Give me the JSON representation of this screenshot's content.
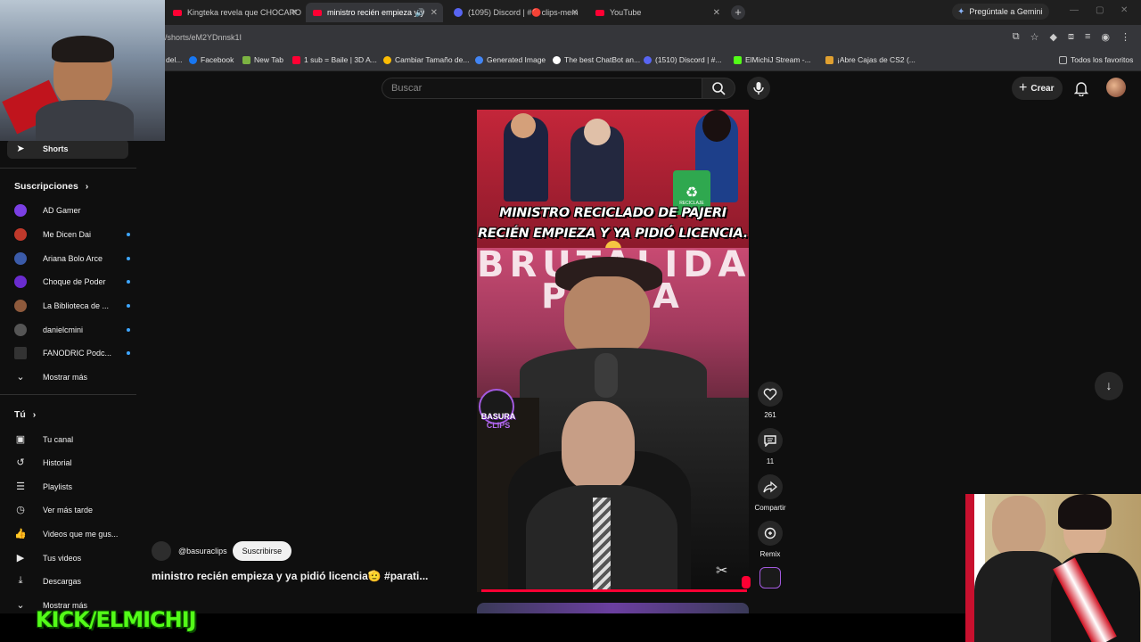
{
  "browser": {
    "tabs": [
      {
        "title": "Kingteka revela que CHOCARO",
        "icon": "youtube-icon"
      },
      {
        "title": "ministro recién empieza y y",
        "icon": "youtube-icon"
      },
      {
        "title": "(1095) Discord | #🔴clips-mem",
        "icon": "discord-icon"
      },
      {
        "title": "YouTube",
        "icon": "youtube-icon"
      }
    ],
    "gemini_label": "Pregúntale a Gemini",
    "url": "/shorts/eM2YDnnsk1I",
    "bookmarks": [
      {
        "label": "del...",
        "color": "#888888"
      },
      {
        "label": "Facebook",
        "color": "#1877f2"
      },
      {
        "label": "New Tab",
        "color": "#7cb342"
      },
      {
        "label": "1 sub = Baile | 3D A...",
        "color": "#ff0033"
      },
      {
        "label": "Cambiar Tamaño de...",
        "color": "#fbbc04"
      },
      {
        "label": "Generated Image",
        "color": "#4285f4"
      },
      {
        "label": "The best ChatBot an...",
        "color": "#ffffff"
      },
      {
        "label": "(1510) Discord | #...",
        "color": "#5865f2"
      },
      {
        "label": "ElMichiJ Stream -...",
        "color": "#53fc18"
      },
      {
        "label": "¡Abre Cajas de CS2 (...",
        "color": "#e0a030"
      }
    ],
    "all_bookmarks": "Todos los favoritos"
  },
  "youtube": {
    "search_placeholder": "Buscar",
    "create_label": "Crear",
    "sidebar": {
      "shorts_label": "Shorts",
      "subscriptions_title": "Suscripciones",
      "subscriptions": [
        {
          "name": "AD Gamer",
          "color": "#7b3fe4",
          "dot": false
        },
        {
          "name": "Me Dicen Dai",
          "color": "#c0392b",
          "dot": true
        },
        {
          "name": "Ariana Bolo Arce",
          "color": "#3b5ba9",
          "dot": true
        },
        {
          "name": "Choque de Poder",
          "color": "#6a2ccf",
          "dot": true
        },
        {
          "name": "La Biblioteca de ...",
          "color": "#8e5a3c",
          "dot": true
        },
        {
          "name": "danielcmini",
          "color": "#555555",
          "dot": true
        },
        {
          "name": "FANODRIC Podc...",
          "color": "#333333",
          "dot": true
        }
      ],
      "show_more": "Mostrar más",
      "you_title": "Tú",
      "you_items": [
        {
          "label": "Tu canal",
          "icon": "channel-icon"
        },
        {
          "label": "Historial",
          "icon": "history-icon"
        },
        {
          "label": "Playlists",
          "icon": "playlists-icon"
        },
        {
          "label": "Ver más tarde",
          "icon": "watch-later-icon"
        },
        {
          "label": "Videos que me gus...",
          "icon": "liked-icon"
        },
        {
          "label": "Tus videos",
          "icon": "your-videos-icon"
        },
        {
          "label": "Descargas",
          "icon": "downloads-icon"
        }
      ],
      "show_more_2": "Mostrar más"
    },
    "short": {
      "headline_line1": "MINISTRO RECICLADO DE PAJERI",
      "headline_line2": "RECIÉN EMPIEZA Y YA PIDIÓ LICENCIA.",
      "watermark_line1": "BRUTALIDAD",
      "watermark_line2": "PO   CA",
      "channel_badge_line1": "BASURA",
      "channel_badge_line2": "CLIPS",
      "reciclaje_label": "RECICLAJE",
      "progress": 0.98
    },
    "actions": {
      "likes": "261",
      "comments": "11",
      "share": "Compartir",
      "remix": "Remix"
    },
    "channel_handle": "@basuraclips",
    "subscribe_label": "Suscribirse",
    "video_title": "ministro recién empieza y ya pidió licencia🫡 #parati..."
  },
  "overlay": {
    "kick_text": "KICK/ELMICHIJ"
  }
}
